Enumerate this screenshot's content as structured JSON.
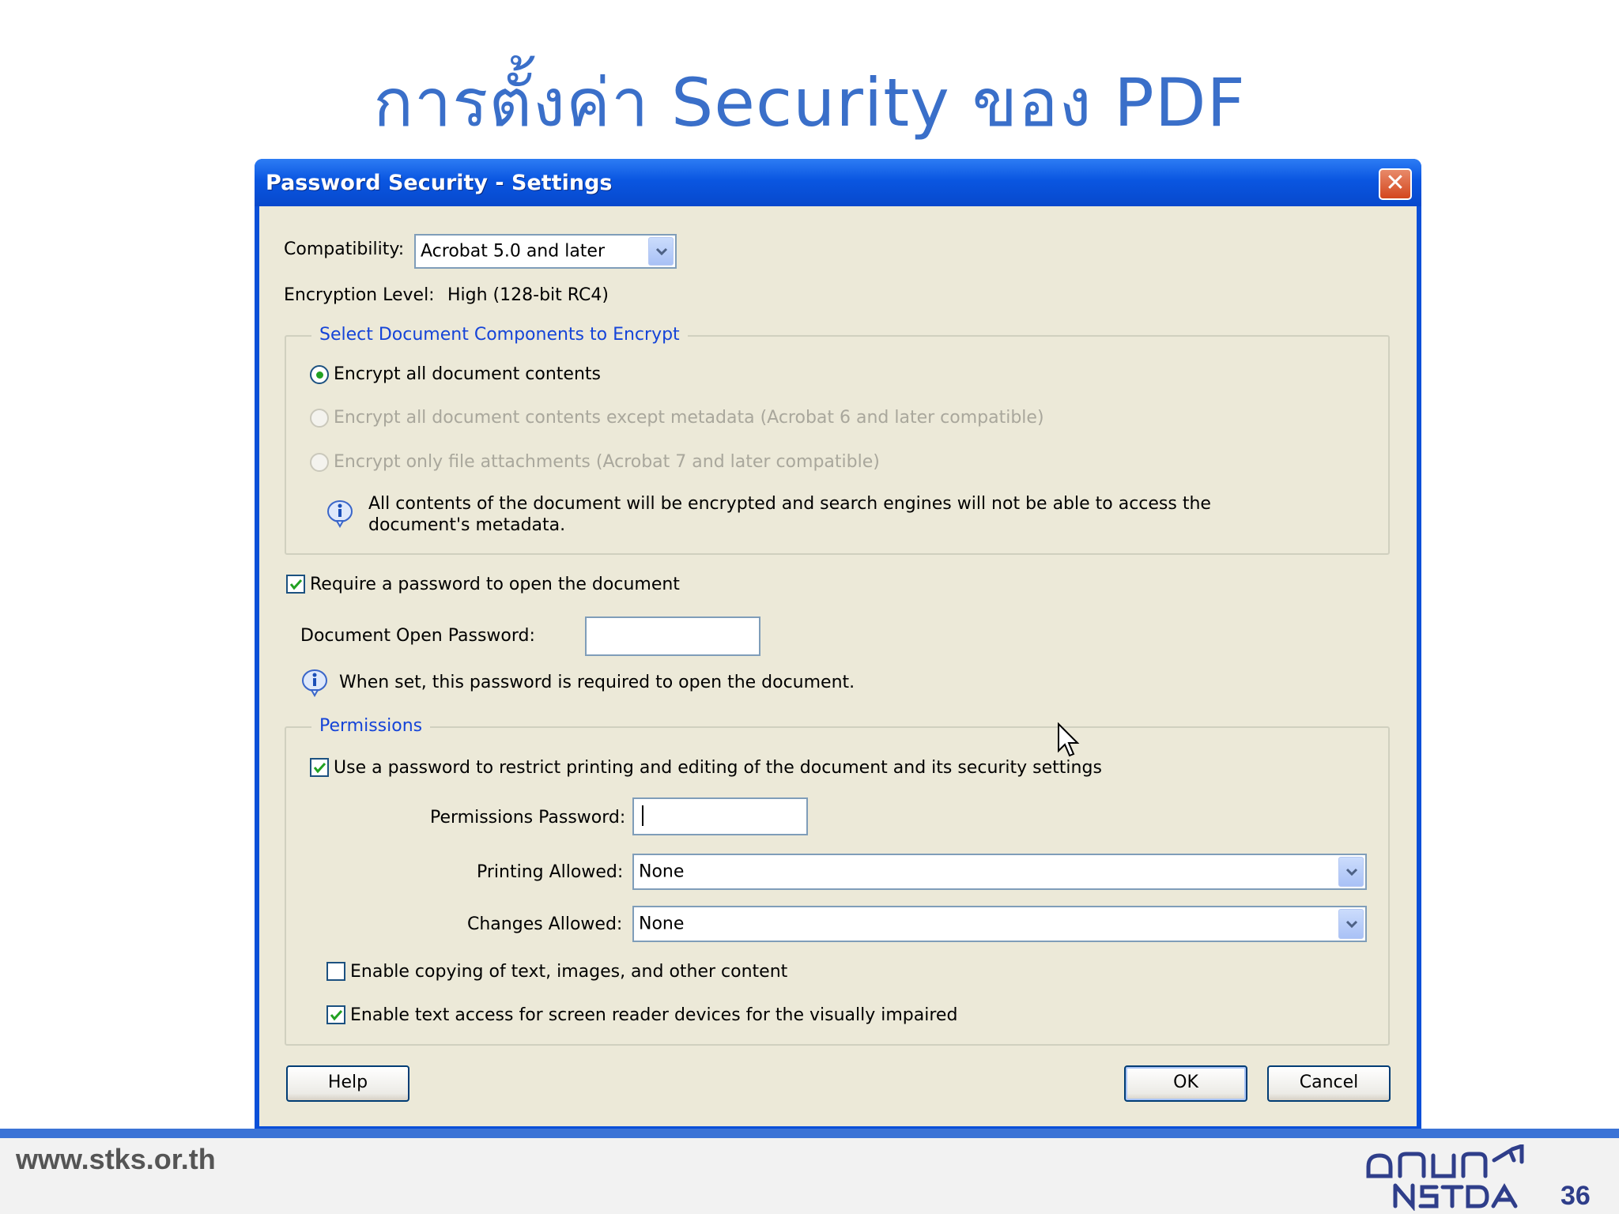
{
  "slide": {
    "title": "การตั้งค่า Security ของ PDF",
    "footer_url": "www.stks.or.th",
    "page_number": "36",
    "logo_text": "สวทช NSTDA"
  },
  "dialog": {
    "title": "Password Security - Settings",
    "compatibility_label": "Compatibility:",
    "compatibility_value": "Acrobat 5.0 and later",
    "encryption_label": "Encryption  Level:",
    "encryption_value": "High (128-bit RC4)",
    "components_group": {
      "legend": "Select Document Components to Encrypt",
      "options": [
        {
          "label": "Encrypt all document contents",
          "selected": true,
          "enabled": true
        },
        {
          "label": "Encrypt all document contents except metadata (Acrobat 6 and later compatible)",
          "selected": false,
          "enabled": false
        },
        {
          "label": "Encrypt only file attachments (Acrobat 7 and later compatible)",
          "selected": false,
          "enabled": false
        }
      ],
      "info_line1": "All contents of the document will be encrypted and search engines will not be able to access the",
      "info_line2": "document's metadata."
    },
    "require_open_password": {
      "label": "Require a password to open the document",
      "checked": true
    },
    "open_password_label": "Document Open Password:",
    "open_password_value": "",
    "open_password_info": "When set, this password is required to open the document.",
    "permissions_group": {
      "legend": "Permissions",
      "restrict_checkbox": {
        "label": "Use a password to restrict printing and editing of the document and its security settings",
        "checked": true
      },
      "permissions_password_label": "Permissions Password:",
      "permissions_password_value": "",
      "printing_label": "Printing Allowed:",
      "printing_value": "None",
      "changes_label": "Changes Allowed:",
      "changes_value": "None",
      "enable_copying": {
        "label": "Enable copying of text, images, and other content",
        "checked": false
      },
      "enable_screen_reader": {
        "label": "Enable text access for screen reader devices for the visually impaired",
        "checked": true
      }
    },
    "buttons": {
      "help": "Help",
      "ok": "OK",
      "cancel": "Cancel"
    }
  }
}
